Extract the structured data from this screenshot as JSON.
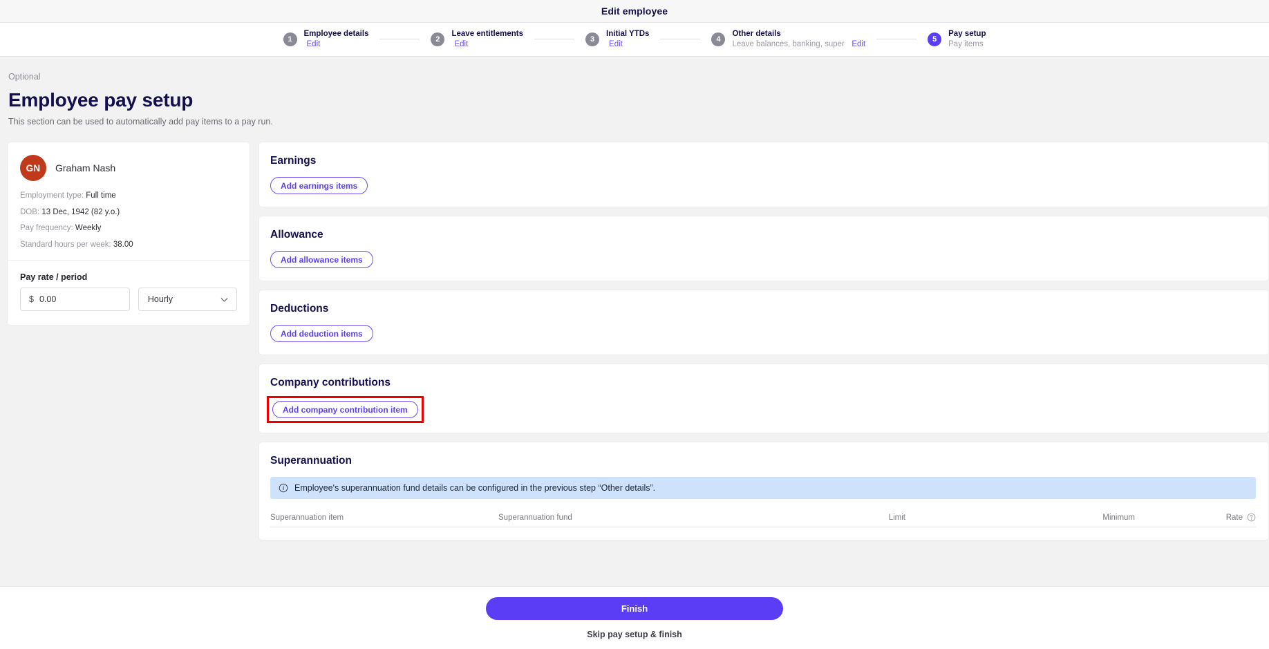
{
  "window": {
    "title": "Edit employee"
  },
  "stepper": {
    "steps": [
      {
        "number": "1",
        "label": "Employee details",
        "sub": "",
        "action": "Edit",
        "active": false
      },
      {
        "number": "2",
        "label": "Leave entitlements",
        "sub": "",
        "action": "Edit",
        "active": false
      },
      {
        "number": "3",
        "label": "Initial YTDs",
        "sub": "",
        "action": "Edit",
        "active": false
      },
      {
        "number": "4",
        "label": "Other details",
        "sub": "Leave balances, banking, super",
        "action": "Edit",
        "active": false
      },
      {
        "number": "5",
        "label": "Pay setup",
        "sub": "Pay items",
        "action": "",
        "active": true
      }
    ]
  },
  "page": {
    "eyebrow": "Optional",
    "title": "Employee pay setup",
    "subtitle": "This section can be used to automatically add pay items to a pay run."
  },
  "employee": {
    "initials": "GN",
    "name": "Graham Nash",
    "avatar_color": "#c0391b",
    "meta": [
      {
        "label": "Employment type:",
        "value": "Full time"
      },
      {
        "label": "DOB:",
        "value": "13 Dec, 1942 (82 y.o.)"
      },
      {
        "label": "Pay frequency:",
        "value": "Weekly"
      },
      {
        "label": "Standard hours per week:",
        "value": "38.00"
      }
    ],
    "pay_rate": {
      "label": "Pay rate / period",
      "currency_symbol": "$",
      "amount": "0.00",
      "amount_placeholder": "0.00",
      "period": "Hourly"
    }
  },
  "sections": {
    "earnings": {
      "title": "Earnings",
      "button": "Add earnings items"
    },
    "allowance": {
      "title": "Allowance",
      "button": "Add allowance items"
    },
    "deductions": {
      "title": "Deductions",
      "button": "Add deduction items"
    },
    "company_contributions": {
      "title": "Company contributions",
      "button": "Add company contribution item",
      "highlighted": true,
      "highlight_color": "#ef0000"
    },
    "superannuation": {
      "title": "Superannuation",
      "info": "Employee's superannuation fund details can be configured in the previous step “Other details”.",
      "columns": {
        "item": "Superannuation item",
        "fund": "Superannuation fund",
        "limit": "Limit",
        "minimum": "Minimum",
        "rate": "Rate"
      }
    }
  },
  "footer": {
    "finish": "Finish",
    "skip": "Skip pay setup & finish"
  },
  "colors": {
    "accent": "#5b3df5",
    "heading": "#130f50",
    "highlight": "#ef0000",
    "info_bg": "#cfe2fb"
  }
}
